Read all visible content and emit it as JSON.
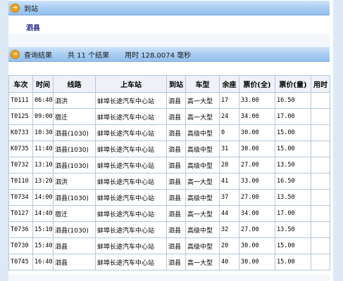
{
  "arrival_panel": {
    "title": "到站",
    "station": "泗县"
  },
  "results_panel": {
    "title": "查询结果",
    "count_text": "共 11 个结果",
    "time_text": "用时 128.0074 毫秒"
  },
  "table": {
    "headers": [
      "车次",
      "时间",
      "线路",
      "上车站",
      "到站",
      "车型",
      "余座",
      "票价(全)",
      "票价(童)",
      "用时"
    ],
    "rows": [
      [
        "T0111",
        "06:40",
        "泗洪",
        "蚌埠长途汽车中心站",
        "泗县",
        "高一大型",
        "17",
        "33.00",
        "16.50",
        ""
      ],
      [
        "T0125",
        "09:00",
        "宿迁",
        "蚌埠长途汽车中心站",
        "泗县",
        "高一大型",
        "24",
        "34.00",
        "17.00",
        ""
      ],
      [
        "K0733",
        "10:30",
        "泗县(1030)",
        "蚌埠长途汽车中心站",
        "泗县",
        "高级中型",
        "0",
        "30.00",
        "15.00",
        ""
      ],
      [
        "K0735",
        "11:40",
        "泗县(1030)",
        "蚌埠长途汽车中心站",
        "泗县",
        "高级中型",
        "31",
        "30.00",
        "15.00",
        ""
      ],
      [
        "T0732",
        "13:10",
        "泗县(1030)",
        "蚌埠长途汽车中心站",
        "泗县",
        "高级中型",
        "28",
        "27.00",
        "13.50",
        ""
      ],
      [
        "T0110",
        "13:20",
        "泗洪",
        "蚌埠长途汽车中心站",
        "泗县",
        "高一大型",
        "41",
        "33.00",
        "16.50",
        ""
      ],
      [
        "T0734",
        "14:00",
        "泗县(1030)",
        "蚌埠长途汽车中心站",
        "泗县",
        "高级中型",
        "37",
        "27.00",
        "13.50",
        ""
      ],
      [
        "T0127",
        "14:40",
        "宿迁",
        "蚌埠长途汽车中心站",
        "泗县",
        "高一大型",
        "44",
        "34.00",
        "17.00",
        ""
      ],
      [
        "T0736",
        "15:10",
        "泗县(1030)",
        "蚌埠长途汽车中心站",
        "泗县",
        "高级中型",
        "32",
        "27.00",
        "13.50",
        ""
      ],
      [
        "T0730",
        "15:40",
        "泗县",
        "蚌埠长途汽车中心站",
        "泗县",
        "高级中型",
        "20",
        "30.00",
        "15.00",
        ""
      ],
      [
        "T0745",
        "16:40",
        "泗县",
        "蚌埠长途汽车中心站",
        "泗县",
        "高一大型",
        "40",
        "30.00",
        "15.00",
        ""
      ]
    ]
  },
  "colors": {
    "header_bar": "#a9cdf2",
    "station_text": "#1a1a8c",
    "icon": "#f0a31a",
    "grid_border": "#b4c7dc"
  }
}
